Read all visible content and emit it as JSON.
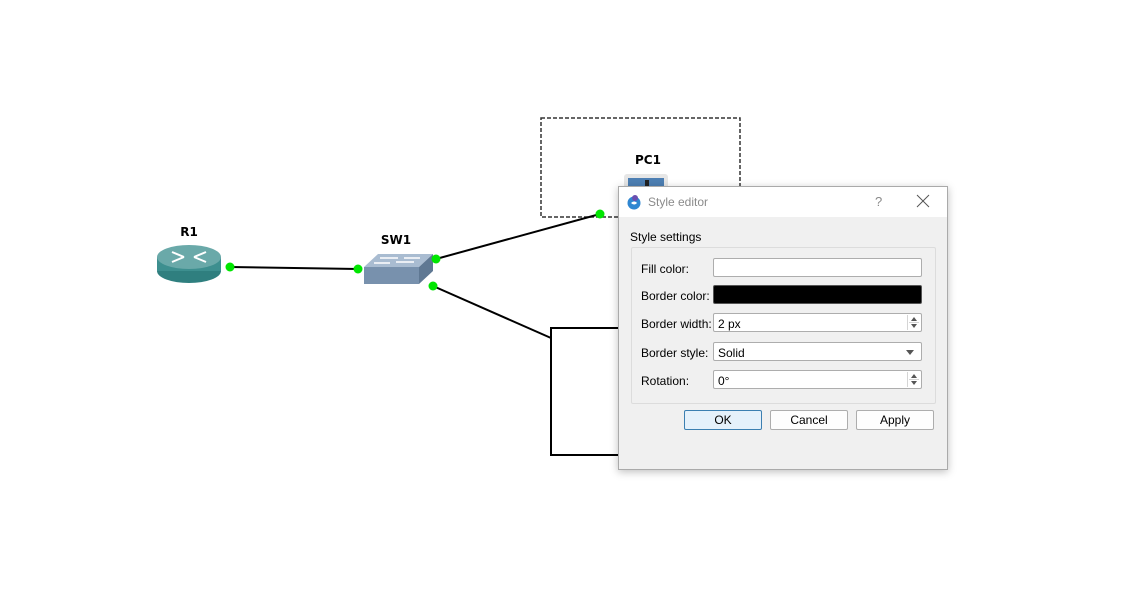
{
  "topology": {
    "nodes": [
      {
        "id": "r1",
        "label": "R1",
        "type": "router"
      },
      {
        "id": "sw1",
        "label": "SW1",
        "type": "switch"
      },
      {
        "id": "pc1",
        "label": "PC1",
        "type": "pc"
      }
    ],
    "links": [
      {
        "from": "R1",
        "to": "SW1"
      },
      {
        "from": "SW1",
        "to": "PC1"
      },
      {
        "from": "SW1",
        "to": "rectangle"
      }
    ],
    "port_color": "#00e600",
    "link_color": "#000000"
  },
  "dialog": {
    "title": "Style editor",
    "help_label": "?",
    "close_icon": "close-icon",
    "group_title": "Style settings",
    "fields": {
      "fill_color": {
        "label": "Fill color:",
        "value": "#ffffff"
      },
      "border_color": {
        "label": "Border color:",
        "value": "#000000"
      },
      "border_width": {
        "label": "Border width:",
        "value": "2 px"
      },
      "border_style": {
        "label": "Border style:",
        "value": "Solid"
      },
      "rotation": {
        "label": "Rotation:",
        "value": "0°"
      }
    },
    "buttons": {
      "ok": "OK",
      "cancel": "Cancel",
      "apply": "Apply"
    }
  }
}
